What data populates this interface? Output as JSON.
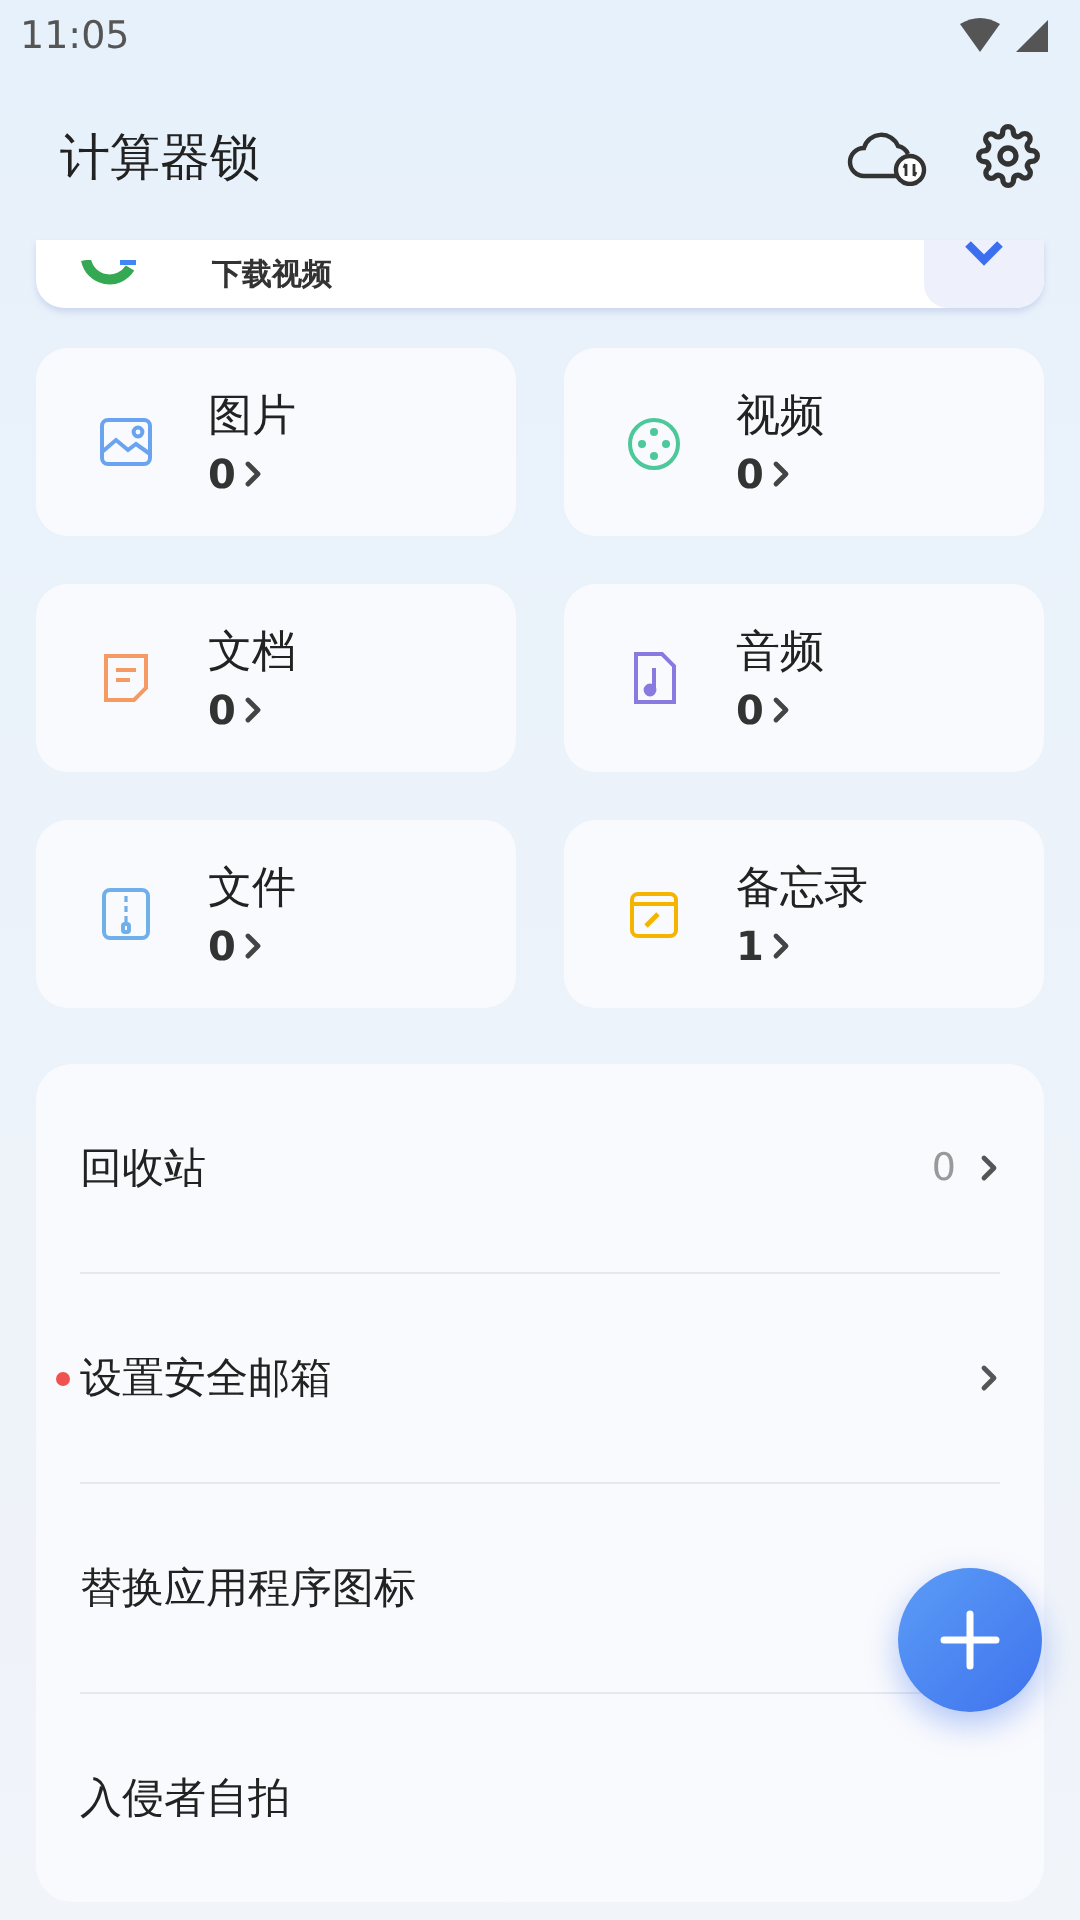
{
  "status_bar": {
    "time": "11:05"
  },
  "header": {
    "title": "计算器锁"
  },
  "banner": {
    "label": "下载视频"
  },
  "categories": [
    {
      "kind": "image",
      "name": "图片",
      "count": "0"
    },
    {
      "kind": "video",
      "name": "视频",
      "count": "0"
    },
    {
      "kind": "document",
      "name": "文档",
      "count": "0"
    },
    {
      "kind": "audio",
      "name": "音频",
      "count": "0"
    },
    {
      "kind": "archive",
      "name": "文件",
      "count": "0"
    },
    {
      "kind": "note",
      "name": "备忘录",
      "count": "1"
    }
  ],
  "menu": [
    {
      "label": "回收站",
      "value": "0",
      "chevron": true,
      "dot": false
    },
    {
      "label": "设置安全邮箱",
      "chevron": true,
      "dot": true
    },
    {
      "label": "替换应用程序图标",
      "chevron": false,
      "dot": false
    },
    {
      "label": "入侵者自拍",
      "chevron": false,
      "dot": false
    }
  ]
}
